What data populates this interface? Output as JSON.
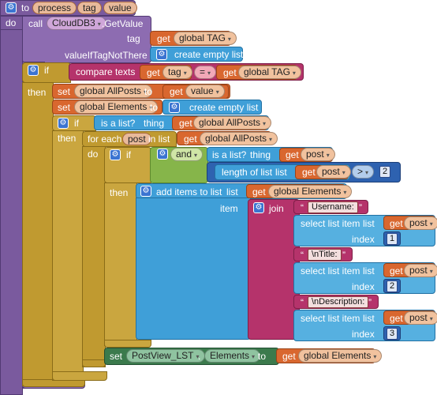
{
  "procedure": {
    "to_label": "to",
    "name": "process",
    "params": [
      "tag",
      "value"
    ],
    "do_label": "do"
  },
  "call": {
    "call_label": "call",
    "component": "CloudDB3",
    "method": ".GetValue",
    "tag_label": "tag",
    "value_if_label": "valueIfTagNotThere"
  },
  "get_label": "get",
  "set_label": "set",
  "to_label": "to",
  "globals": {
    "tag": "global TAG",
    "all_posts": "global AllPosts",
    "elements": "global Elements"
  },
  "create_empty_list": "create empty list",
  "if_block": {
    "if_label": "if",
    "then_label": "then",
    "compare_label": "compare texts",
    "compare_op": "=",
    "local_tag": "tag",
    "local_value": "value"
  },
  "inner_if": {
    "if_label": "if",
    "then_label": "then",
    "is_list_label": "is a list?",
    "thing_label": "thing"
  },
  "foreach": {
    "label": "for each",
    "var": "post",
    "in_list_label": "in list",
    "do_label": "do"
  },
  "nested_if": {
    "if_label": "if",
    "then_label": "then",
    "and_label": "and",
    "is_list_label": "is a list?",
    "thing_label": "thing",
    "post_var": "post",
    "length_label": "length of list",
    "list_label": "list",
    "gt_op": ">",
    "gt_value": "2"
  },
  "add_items": {
    "label": "add items to list",
    "list_label": "list",
    "item_label": "item",
    "join_label": "join"
  },
  "join_items": [
    {
      "string": "Username:",
      "select_label": "select list item",
      "list_label": "list",
      "index_label": "index",
      "var": "post",
      "index": "1"
    },
    {
      "string": "\\nTitle:",
      "select_label": "select list item",
      "list_label": "list",
      "index_label": "index",
      "var": "post",
      "index": "2"
    },
    {
      "string": "\\nDescription:",
      "select_label": "select list item",
      "list_label": "list",
      "index_label": "index",
      "var": "post",
      "index": "3"
    }
  ],
  "final_set": {
    "set_label": "set",
    "component": "PostView_LST",
    "dot": ".",
    "property": "Elements",
    "to_label": "to"
  },
  "quote_open": "“",
  "quote_close": "”",
  "dropdown_arrow": "▾",
  "gear_icon": "⚙"
}
